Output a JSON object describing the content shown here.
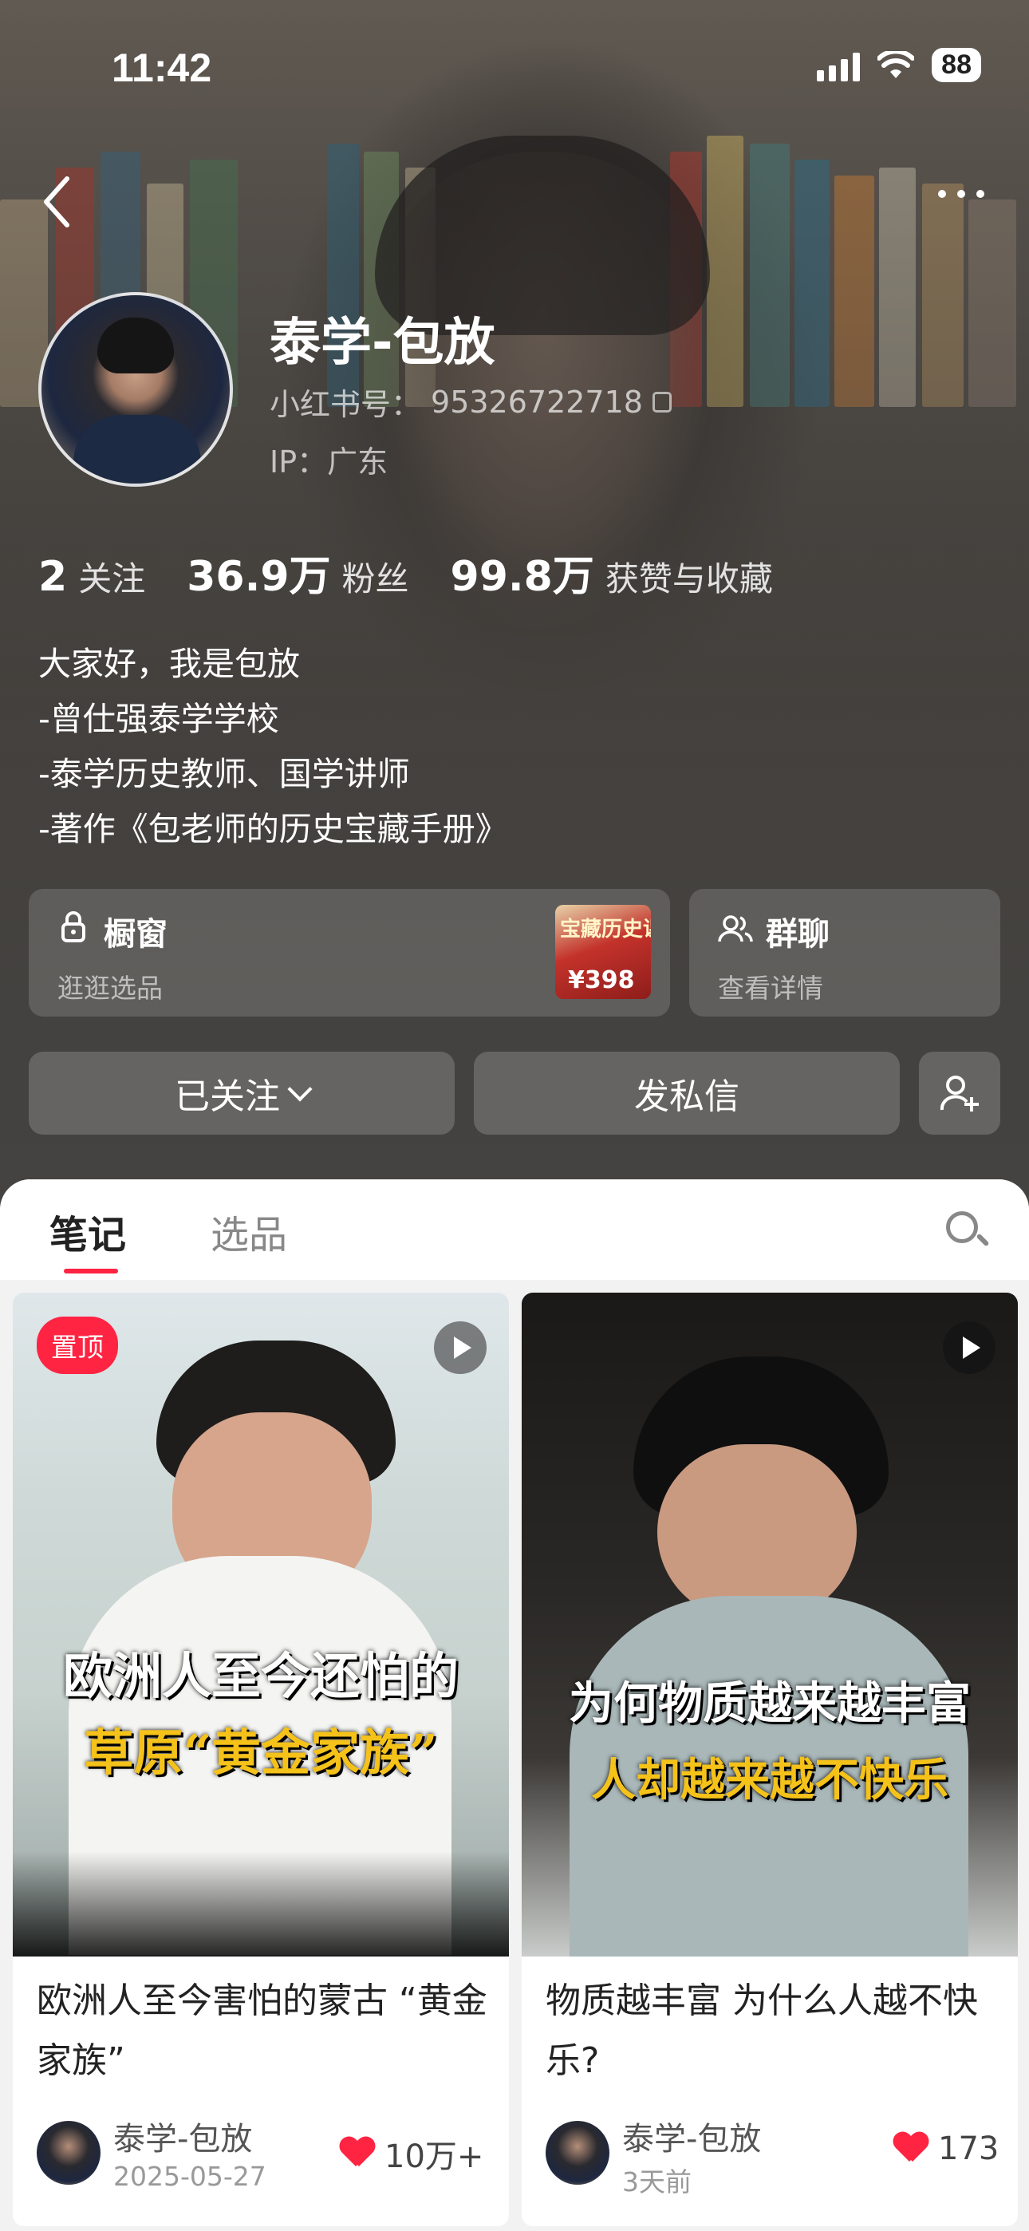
{
  "status": {
    "time": "11:42",
    "battery": "88"
  },
  "profile": {
    "name": "泰学-包放",
    "id_label": "小红书号：",
    "id_value": "95326722718",
    "ip": "IP：广东",
    "stats": [
      {
        "num": "2",
        "label": "关注"
      },
      {
        "num": "36.9万",
        "label": "粉丝"
      },
      {
        "num": "99.8万",
        "label": "获赞与收藏"
      }
    ],
    "bio": [
      "大家好，我是包放",
      "-曾仕强泰学学校",
      "-泰学历史教师、国学讲师",
      "-著作《包老师的历史宝藏手册》"
    ]
  },
  "shop_card": {
    "title": "橱窗",
    "sub": "逛逛选品",
    "thumb_title": "宝藏历史课",
    "price": "¥398"
  },
  "group_card": {
    "title": "群聊",
    "sub": "查看详情"
  },
  "buttons": {
    "follow": "已关注",
    "message": "发私信"
  },
  "tabs": [
    "笔记",
    "选品"
  ],
  "notes": [
    {
      "pinned": "置顶",
      "caption_line1": "欧洲人至今还怕的",
      "caption_line2": "草原“黄金家族”",
      "title": "欧洲人至今害怕的蒙古 “黄金家族”",
      "author": "泰学-包放",
      "date": "2025-05-27",
      "likes": "10万+"
    },
    {
      "caption_line1": "为何物质越来越丰富",
      "caption_line2": "人却越来越不快乐",
      "title": "物质越丰富 为什么人越不快乐?",
      "author": "泰学-包放",
      "date": "3天前",
      "likes": "173"
    }
  ],
  "colors": {
    "accent": "#ff2442",
    "caption_yellow": "#f5c21a"
  },
  "icons": [
    "back-icon",
    "more-icon",
    "copy-icon",
    "lock-icon",
    "group-icon",
    "chevron-down-icon",
    "add-friend-icon",
    "search-icon",
    "play-icon",
    "heart-icon"
  ]
}
